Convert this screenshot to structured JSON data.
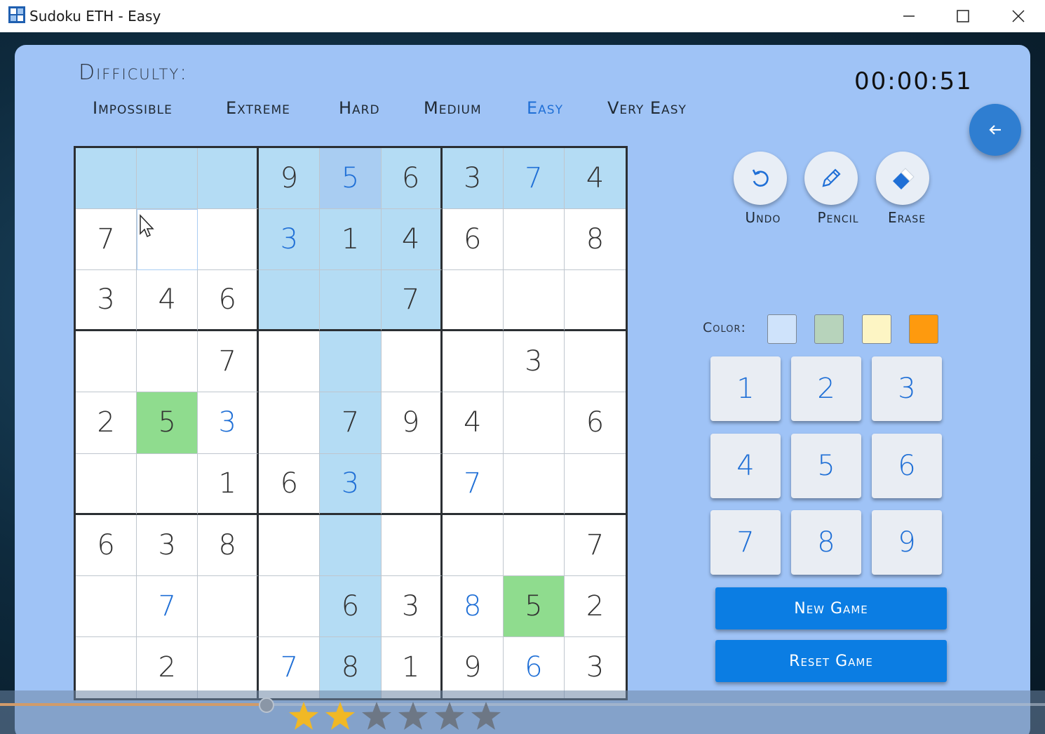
{
  "window": {
    "title": "Sudoku ETH - Easy"
  },
  "difficulty": {
    "label": "Difficulty:",
    "options": [
      "Impossible",
      "Extreme",
      "Hard",
      "Medium",
      "Easy",
      "Very Easy"
    ],
    "selected": "Easy"
  },
  "timer": "00:00:51",
  "board": {
    "cells": [
      [
        "",
        "",
        "",
        "9",
        "5",
        "6",
        "3",
        "7",
        "4"
      ],
      [
        "7",
        "",
        "",
        "3",
        "1",
        "4",
        "6",
        "",
        "8"
      ],
      [
        "3",
        "4",
        "6",
        "",
        "",
        "7",
        "",
        "",
        ""
      ],
      [
        "",
        "",
        "7",
        "",
        "",
        "",
        "",
        "3",
        ""
      ],
      [
        "2",
        "5",
        "3",
        "",
        "7",
        "9",
        "4",
        "",
        "6"
      ],
      [
        "",
        "",
        "1",
        "6",
        "3",
        "",
        "7",
        "",
        ""
      ],
      [
        "6",
        "3",
        "8",
        "",
        "",
        "",
        "",
        "",
        "7"
      ],
      [
        "",
        "7",
        "",
        "",
        "6",
        "3",
        "8",
        "5",
        "2"
      ],
      [
        "",
        "2",
        "",
        "7",
        "8",
        "1",
        "9",
        "6",
        "3"
      ]
    ],
    "user_entered": [
      [
        0,
        4
      ],
      [
        0,
        7
      ],
      [
        1,
        3
      ],
      [
        4,
        2
      ],
      [
        5,
        4
      ],
      [
        5,
        6
      ],
      [
        7,
        1
      ],
      [
        7,
        6
      ],
      [
        8,
        3
      ],
      [
        8,
        7
      ]
    ],
    "selected_cell": [
      0,
      4
    ],
    "green_cells": [
      [
        4,
        1
      ],
      [
        7,
        7
      ]
    ]
  },
  "tools": {
    "undo": "Undo",
    "pencil": "Pencil",
    "erase": "Erase"
  },
  "color": {
    "label": "Color:",
    "swatches": [
      "#cfe3fb",
      "#b7d3bb",
      "#fdf5c4",
      "#fe9a0e"
    ]
  },
  "numpad": [
    "1",
    "2",
    "3",
    "4",
    "5",
    "6",
    "7",
    "8",
    "9"
  ],
  "actions": {
    "new_game": "New Game",
    "reset_game": "Reset Game"
  },
  "rating": {
    "filled": 2,
    "total": 6
  },
  "video_progress": 0.255
}
